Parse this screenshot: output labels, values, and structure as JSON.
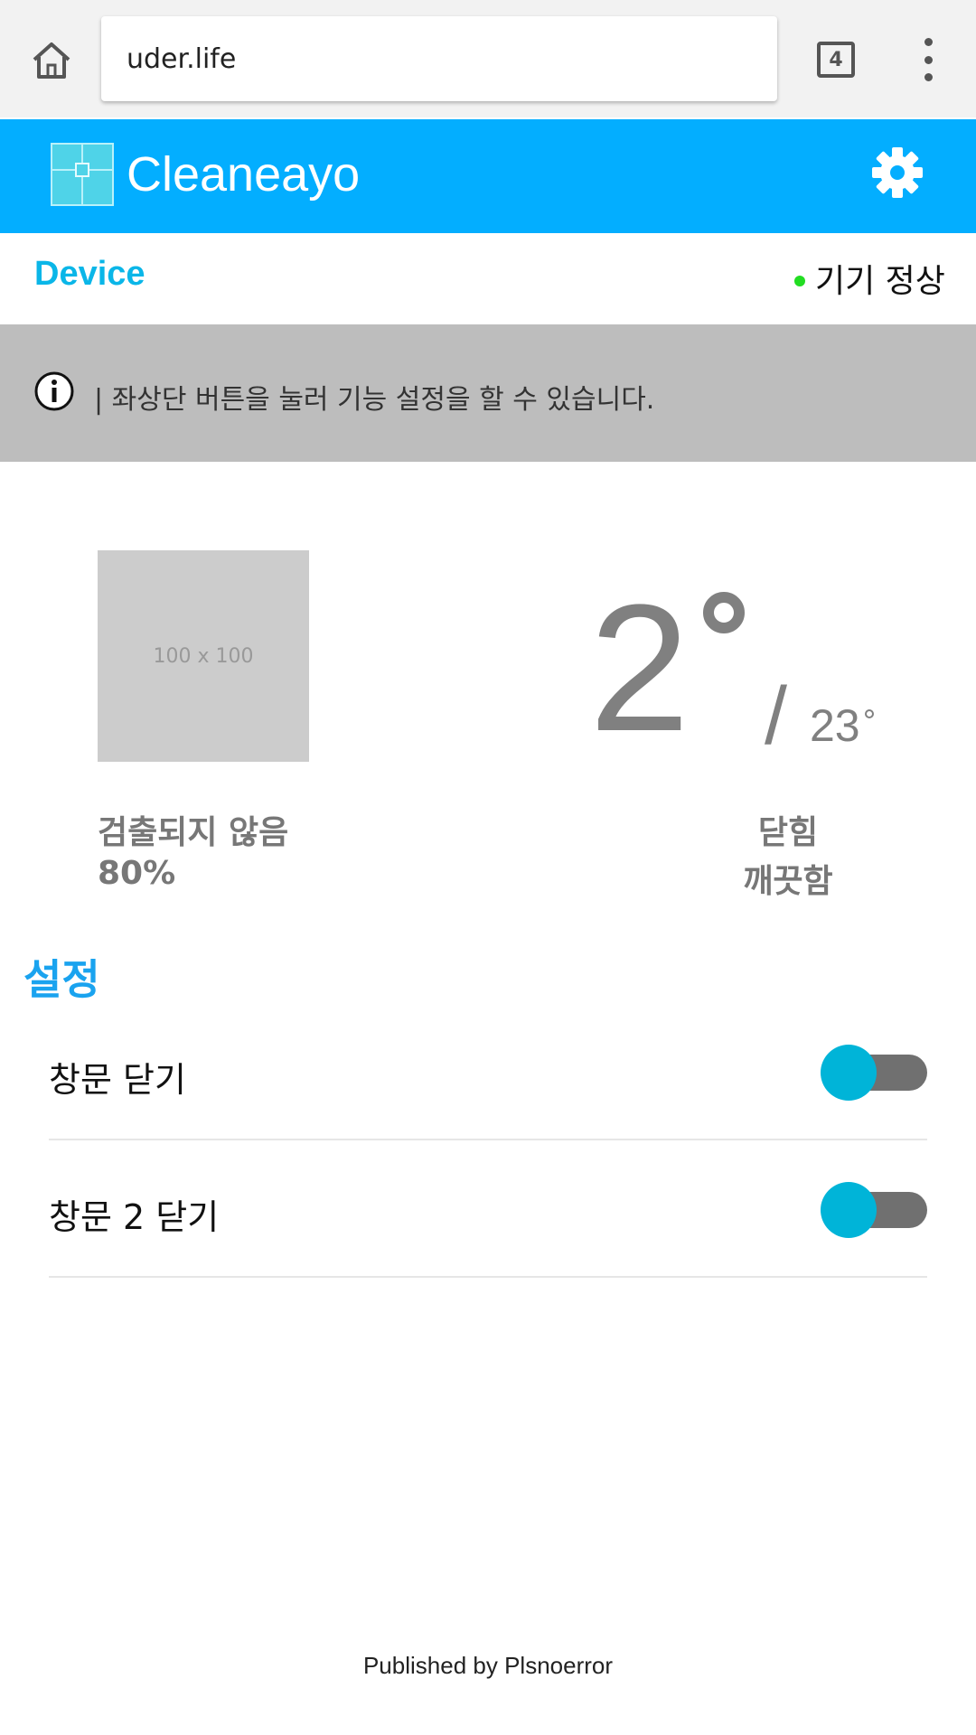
{
  "browser": {
    "url": "uder.life",
    "tab_count": "4",
    "icons": [
      "home-icon",
      "tabs-icon",
      "more-vert-icon"
    ]
  },
  "header": {
    "app_name": "Cleaneayo",
    "icons": [
      "app-logo",
      "gear-icon"
    ],
    "background_color": "#03aeff"
  },
  "device": {
    "label": "Device",
    "status": "기기 정상",
    "status_color": "#22dd22"
  },
  "banner": {
    "icon": "info-icon",
    "text": "| 좌상단 버튼을 눌러 기능 설정을 할 수 있습니다."
  },
  "panel": {
    "placeholder_text": "100 x 100",
    "detection_status": "검출되지 않음",
    "percent": "80%",
    "temperature_current": "2",
    "temperature_separator": "/",
    "temperature_target": "23",
    "window_state": "닫힘",
    "air_state": "깨끗함"
  },
  "settings": {
    "heading": "설정",
    "items": [
      {
        "label": "창문 닫기",
        "on": false
      },
      {
        "label": "창문 2 닫기",
        "on": false
      }
    ],
    "toggle_knob_color": "#00b4d8"
  },
  "footer": {
    "text": "Published by Plsnoerror"
  }
}
